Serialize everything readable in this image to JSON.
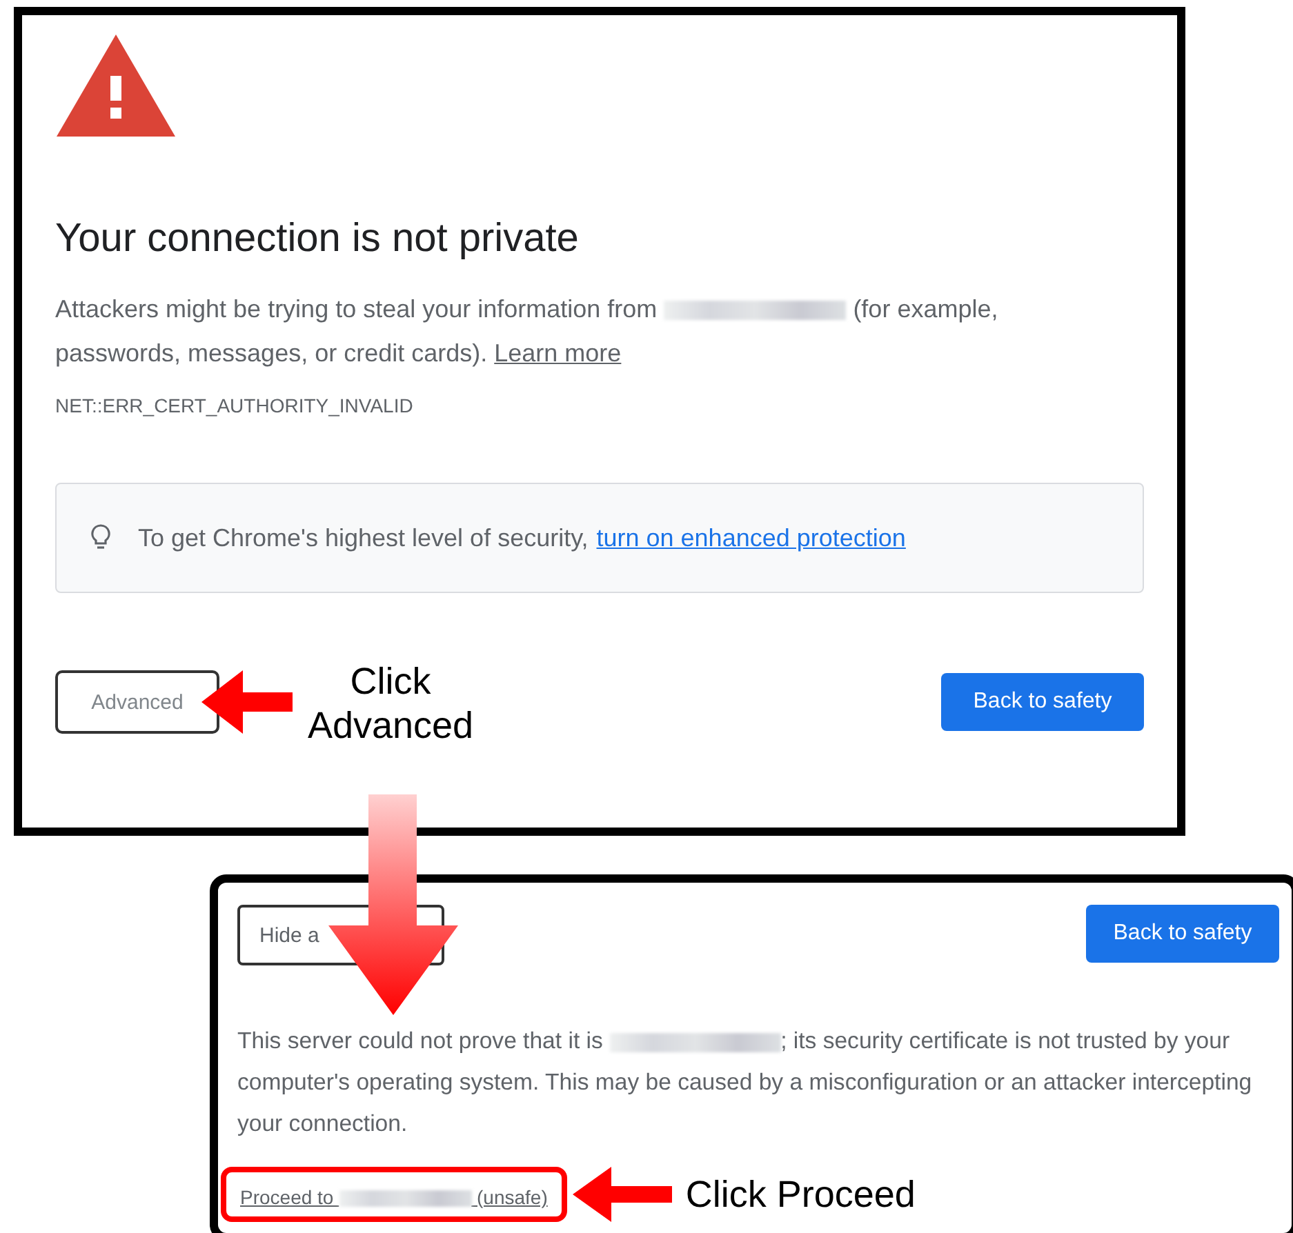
{
  "warning_page": {
    "title": "Your connection is not private",
    "message_before": "Attackers might be trying to steal your information from",
    "message_after": "(for example, passwords, messages, or credit cards).",
    "learn_more_link": "Learn more",
    "error_code": "NET::ERR_CERT_AUTHORITY_INVALID",
    "info_text": "To get Chrome's highest level of security,",
    "info_link": "turn on enhanced protection",
    "advanced_button": "Advanced",
    "back_button": "Back to safety"
  },
  "advanced_page": {
    "hide_button": "Hide a",
    "back_button": "Back to safety",
    "message_before": "This server could not prove that it is",
    "message_after": "; its security certificate is not trusted by your computer's operating system. This may be caused by a misconfiguration or an attacker intercepting your connection.",
    "proceed_before": "Proceed to",
    "proceed_after": "(unsafe)"
  },
  "annotations": [
    {
      "text": "Click Advanced"
    },
    {
      "text": "Click Proceed"
    }
  ]
}
